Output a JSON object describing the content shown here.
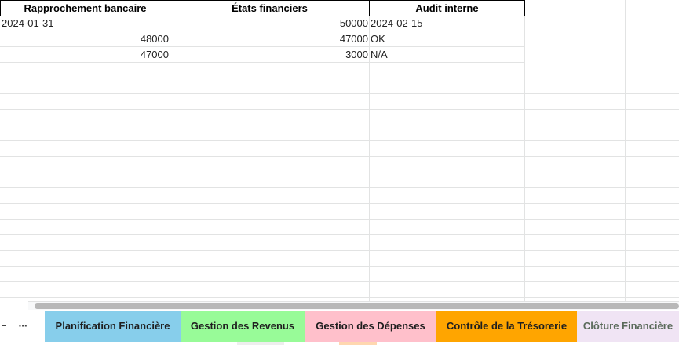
{
  "columns": {
    "A": "Rapprochement bancaire",
    "B": "États financiers",
    "C": "Audit interne"
  },
  "rows": [
    {
      "a": "2024-01-31",
      "b": "50000",
      "c": "2024-02-15"
    },
    {
      "a": "48000",
      "b": "47000",
      "c": "OK"
    },
    {
      "a": "47000",
      "b": "3000",
      "c": "N/A"
    }
  ],
  "tabbar": {
    "menu_icon": "hamburger-menu-icon",
    "more_label": "···",
    "tabs": [
      {
        "label": "Planification Financière",
        "color": "#87ceeb"
      },
      {
        "label": "Gestion des Revenus",
        "color": "#98fb98"
      },
      {
        "label": "Gestion des Dépenses",
        "color": "#ffc0cb"
      },
      {
        "label": "Contrôle de la Trésorerie",
        "color": "#ffa500"
      },
      {
        "label": "Clôture Financière",
        "color": "#f0e4f4"
      }
    ]
  },
  "colors": {
    "gridline": "#e2e3e3",
    "header_border": "#000000",
    "scroll_thumb": "#b8b8b8"
  }
}
